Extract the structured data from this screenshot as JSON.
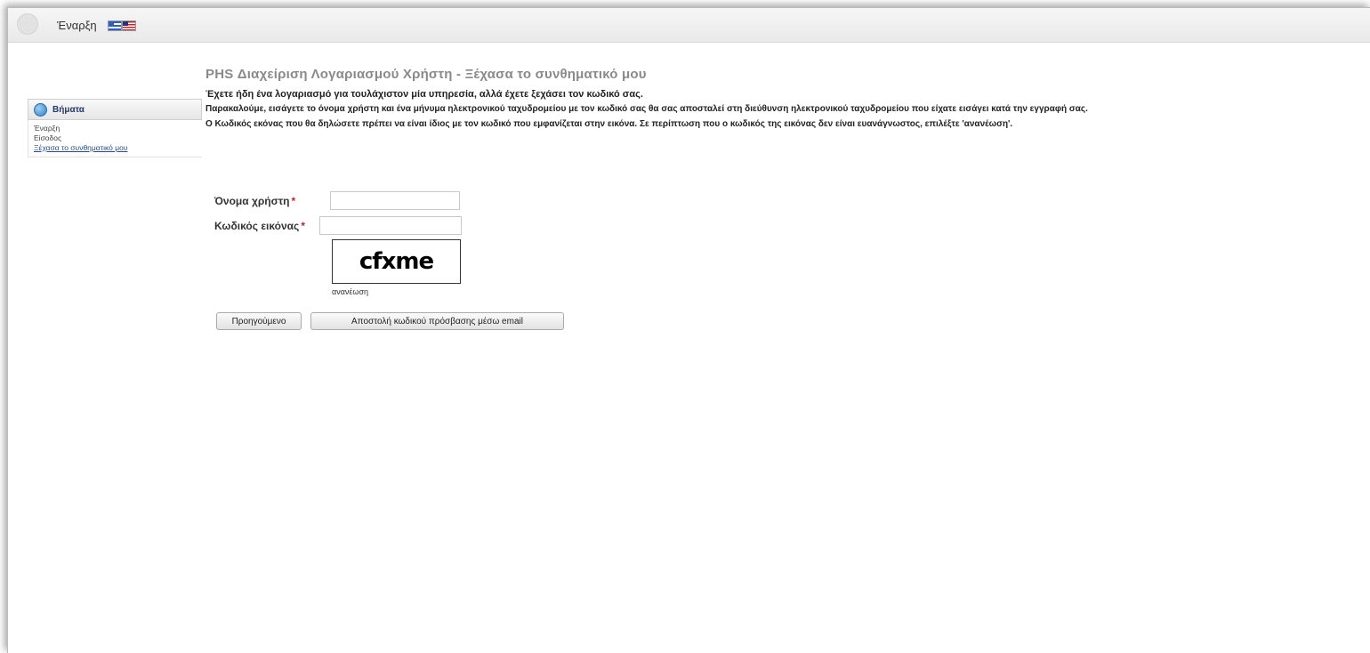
{
  "topbar": {
    "home_label": "Έναρξη"
  },
  "sidebar": {
    "header": "Βήματα",
    "items": [
      {
        "label": "Έναρξη"
      },
      {
        "label": "Είσοδος"
      },
      {
        "label": "Ξέχασα το συνθηματικό μου"
      }
    ]
  },
  "main": {
    "title": "PHS Διαχείριση Λογαριασμού Χρήστη - Ξέχασα το συνθηματικό μου",
    "intro": "Έχετε ήδη ένα λογαριασμό για τουλάχιστον μία υπηρεσία, αλλά έχετε ξεχάσει τον κωδικό σας.",
    "para1": "Παρακαλούμε, εισάγετε το όνομα χρήστη και ένα μήνυμα ηλεκτρονικού ταχυδρομείου με τον κωδικό σας θα σας αποσταλεί στη διεύθυνση ηλεκτρονικού ταχυδρομείου που είχατε εισάγει κατά την εγγραφή σας.",
    "para2": "Ο Κωδικός εκόνας που θα δηλώσετε πρέπει να είναι ίδιος με τον κωδικό που εμφανίζεται στην εικόνα. Σε περίπτωση που ο κωδικός της εικόνας δεν είναι ευανάγνωστος, επιλέξτε 'ανανέωση'.",
    "username_label": "Όνομα χρήστη",
    "username_value": "",
    "captcha_label": "Κωδικός εικόνας",
    "captcha_value": "",
    "required_mark": "*",
    "captcha_text": "cfxme",
    "refresh_label": "ανανέωση",
    "prev_button": "Προηγούμενο",
    "send_button": "Αποστολή κωδικού πρόσβασης μέσω email"
  }
}
